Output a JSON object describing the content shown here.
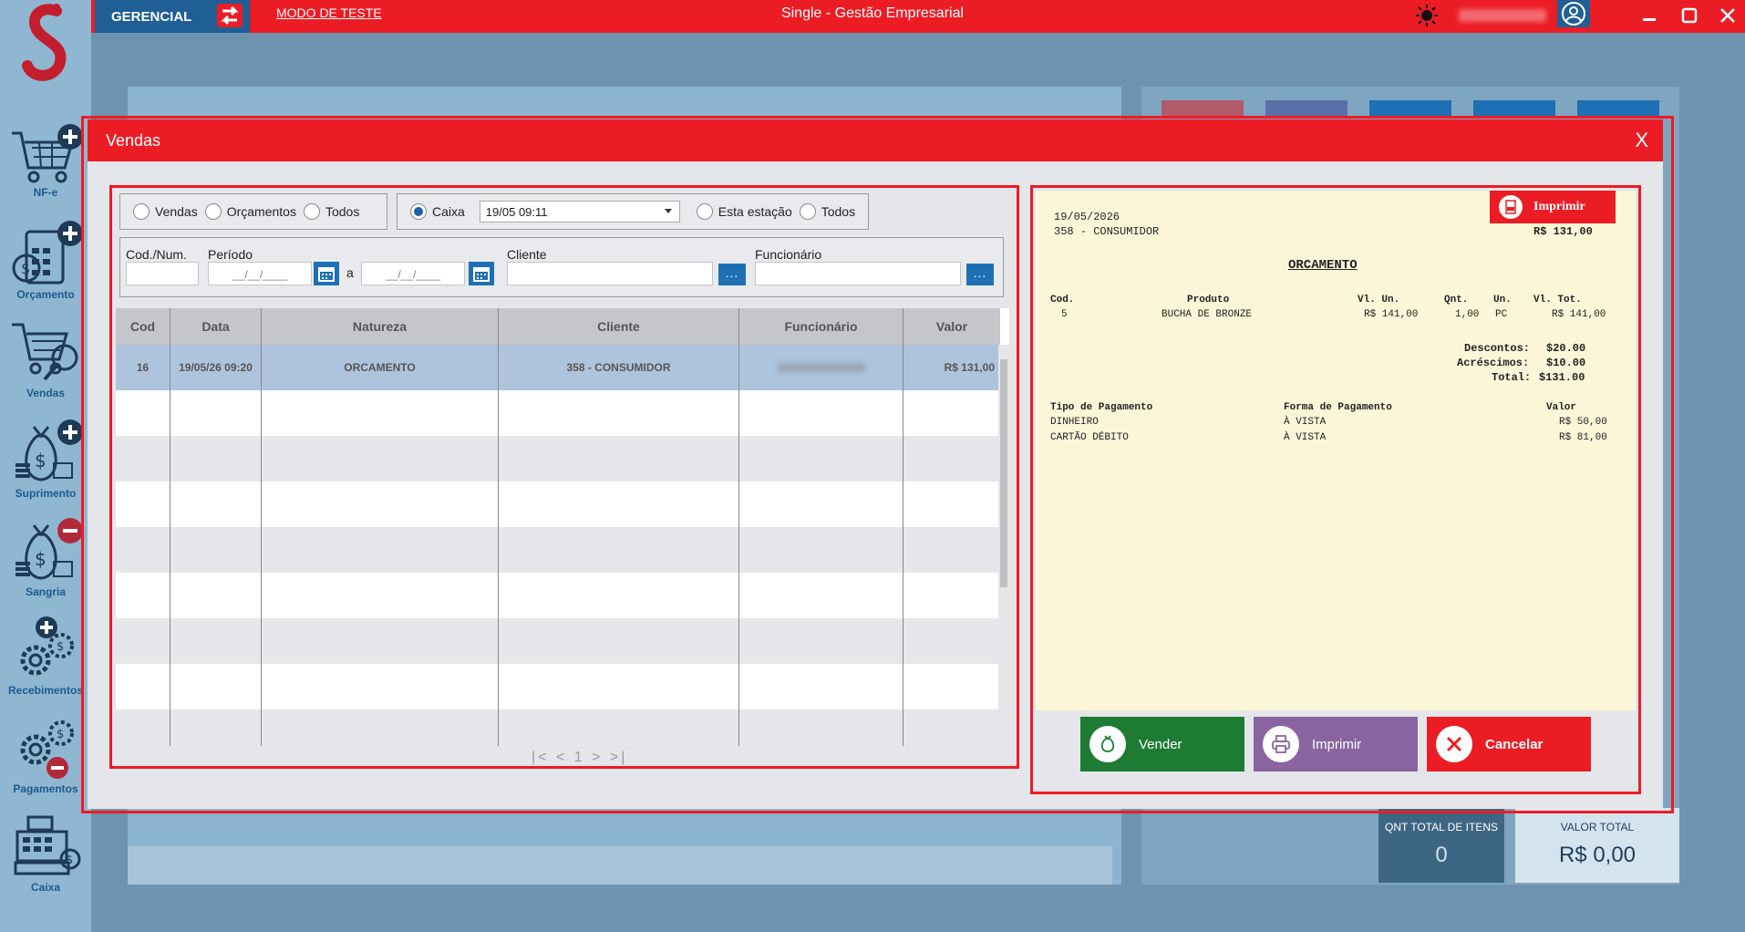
{
  "topbar": {
    "mode_label": "GERENCIAL",
    "test_mode_link": "MODO DE TESTE",
    "app_title": "Single - Gestão Empresarial"
  },
  "sidebar": {
    "items": [
      {
        "label": "NF-e",
        "icon": "cart-plus-icon"
      },
      {
        "label": "Orçamento",
        "icon": "calculator-plus-icon"
      },
      {
        "label": "Vendas",
        "icon": "cart-search-icon"
      },
      {
        "label": "Suprimento",
        "icon": "money-bag-plus-icon"
      },
      {
        "label": "Sangria",
        "icon": "money-bag-minus-icon"
      },
      {
        "label": "Recebimentos",
        "icon": "gears-plus-icon"
      },
      {
        "label": "Pagamentos",
        "icon": "gears-minus-icon"
      },
      {
        "label": "Caixa",
        "icon": "cash-register-icon"
      }
    ]
  },
  "background": {
    "qnt_total_label": "QNT TOTAL DE ITENS",
    "qnt_total_value": "0",
    "valor_total_label": "VALOR TOTAL",
    "valor_total_value": "R$ 0,00"
  },
  "modal": {
    "title": "Vendas",
    "close": "X",
    "filters": {
      "type_radios": [
        "Vendas",
        "Orçamentos",
        "Todos"
      ],
      "caixa_label": "Caixa",
      "caixa_value": "19/05 09:11",
      "station_radios": [
        "Esta estação",
        "Todos"
      ],
      "cod_label": "Cod./Num.",
      "periodo_label": "Período",
      "date_placeholder": "__/__/____",
      "a_label": "a",
      "cliente_label": "Cliente",
      "funcionario_label": "Funcionário",
      "dots": "..."
    },
    "grid": {
      "columns": [
        "Cod",
        "Data",
        "Natureza",
        "Cliente",
        "Funcionário",
        "Valor"
      ],
      "rows": [
        {
          "cod": "16",
          "data": "19/05/26 09:20",
          "natureza": "ORCAMENTO",
          "cliente": "358 - CONSUMIDOR",
          "funcionario": "",
          "valor": "R$ 131,00"
        }
      ]
    },
    "pager": "|< <  1  > >|",
    "receipt": {
      "date": "19/05/2026",
      "customer": "358 - CONSUMIDOR",
      "total_top": "R$ 131,00",
      "print_label": "Imprimir",
      "heading": "ORCAMENTO",
      "col_cod": "Cod.",
      "col_produto": "Produto",
      "col_vl_un": "Vl. Un.",
      "col_qnt": "Qnt.",
      "col_un": "Un.",
      "col_vl_tot": "Vl. Tot.",
      "item_cod": "5",
      "item_produto": "BUCHA DE BRONZE",
      "item_vl_un": "R$ 141,00",
      "item_qnt": "1,00",
      "item_un": "PC",
      "item_vl_tot": "R$ 141,00",
      "descontos_label": "Descontos:",
      "descontos_value": "$20.00",
      "acrescimos_label": "Acréscimos:",
      "acrescimos_value": "$10.00",
      "total_label": "Total:",
      "total_value": "$131.00",
      "pay_col_tipo": "Tipo de Pagamento",
      "pay_col_forma": "Forma de Pagamento",
      "pay_col_valor": "Valor",
      "payments": [
        {
          "tipo": "DINHEIRO",
          "forma": "À VISTA",
          "valor": "R$ 50,00"
        },
        {
          "tipo": "CARTÃO DÉBITO",
          "forma": "À VISTA",
          "valor": "R$ 81,00"
        }
      ]
    },
    "actions": {
      "vender": "Vender",
      "imprimir": "Imprimir",
      "cancelar": "Cancelar"
    }
  },
  "colors": {
    "accent_red": "#ec1c24",
    "brand_blue": "#1f5f96",
    "vender_green": "#1e7b34",
    "imprimir_purple": "#8a64a0"
  }
}
